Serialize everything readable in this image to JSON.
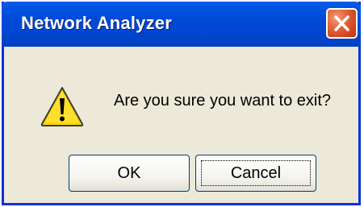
{
  "window": {
    "title": "Network Analyzer"
  },
  "dialog": {
    "icon": "warning-icon",
    "message": "Are you sure you want to exit?"
  },
  "buttons": {
    "ok_label": "OK",
    "cancel_label": "Cancel"
  },
  "colors": {
    "titlebar": "#0054e3",
    "dialog_background": "#ece9d8",
    "close_button": "#e0532b",
    "warning_yellow": "#ffd800"
  }
}
